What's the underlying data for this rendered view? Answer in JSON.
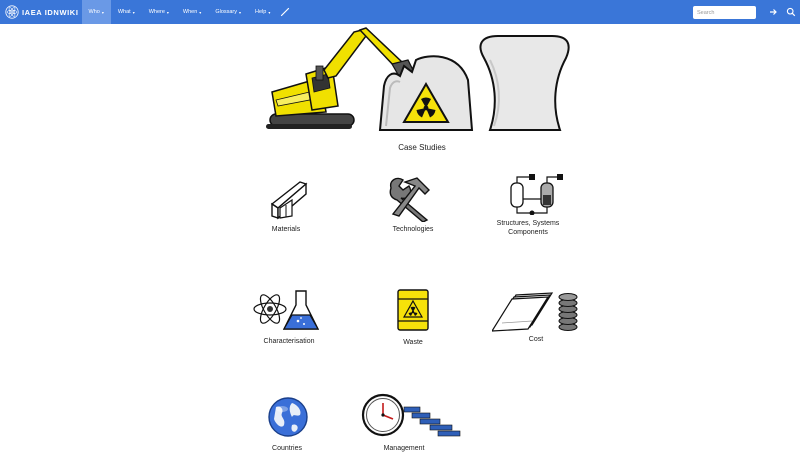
{
  "navbar": {
    "brand": "IAEA IDNWIKI",
    "items": [
      {
        "label": "Who",
        "active": true
      },
      {
        "label": "What",
        "active": false
      },
      {
        "label": "Where",
        "active": false
      },
      {
        "label": "When",
        "active": false
      },
      {
        "label": "Glossary",
        "active": false
      },
      {
        "label": "Help",
        "active": false
      }
    ],
    "caret": "▾",
    "search_placeholder": "Search"
  },
  "hero": {
    "label": "Case Studies"
  },
  "tiles": {
    "materials": "Materials",
    "technologies": "Technologies",
    "sscs_line1": "Structures, Systems",
    "sscs_line2": "Components",
    "characterisation": "Characterisation",
    "waste": "Waste",
    "cost": "Cost",
    "countries": "Countries",
    "management": "Management"
  },
  "colors": {
    "nav_bg": "#3a76d8",
    "nav_active": "#6a99e6",
    "warning_yellow": "#f6e20a",
    "excavator_yellow": "#f0e000"
  }
}
